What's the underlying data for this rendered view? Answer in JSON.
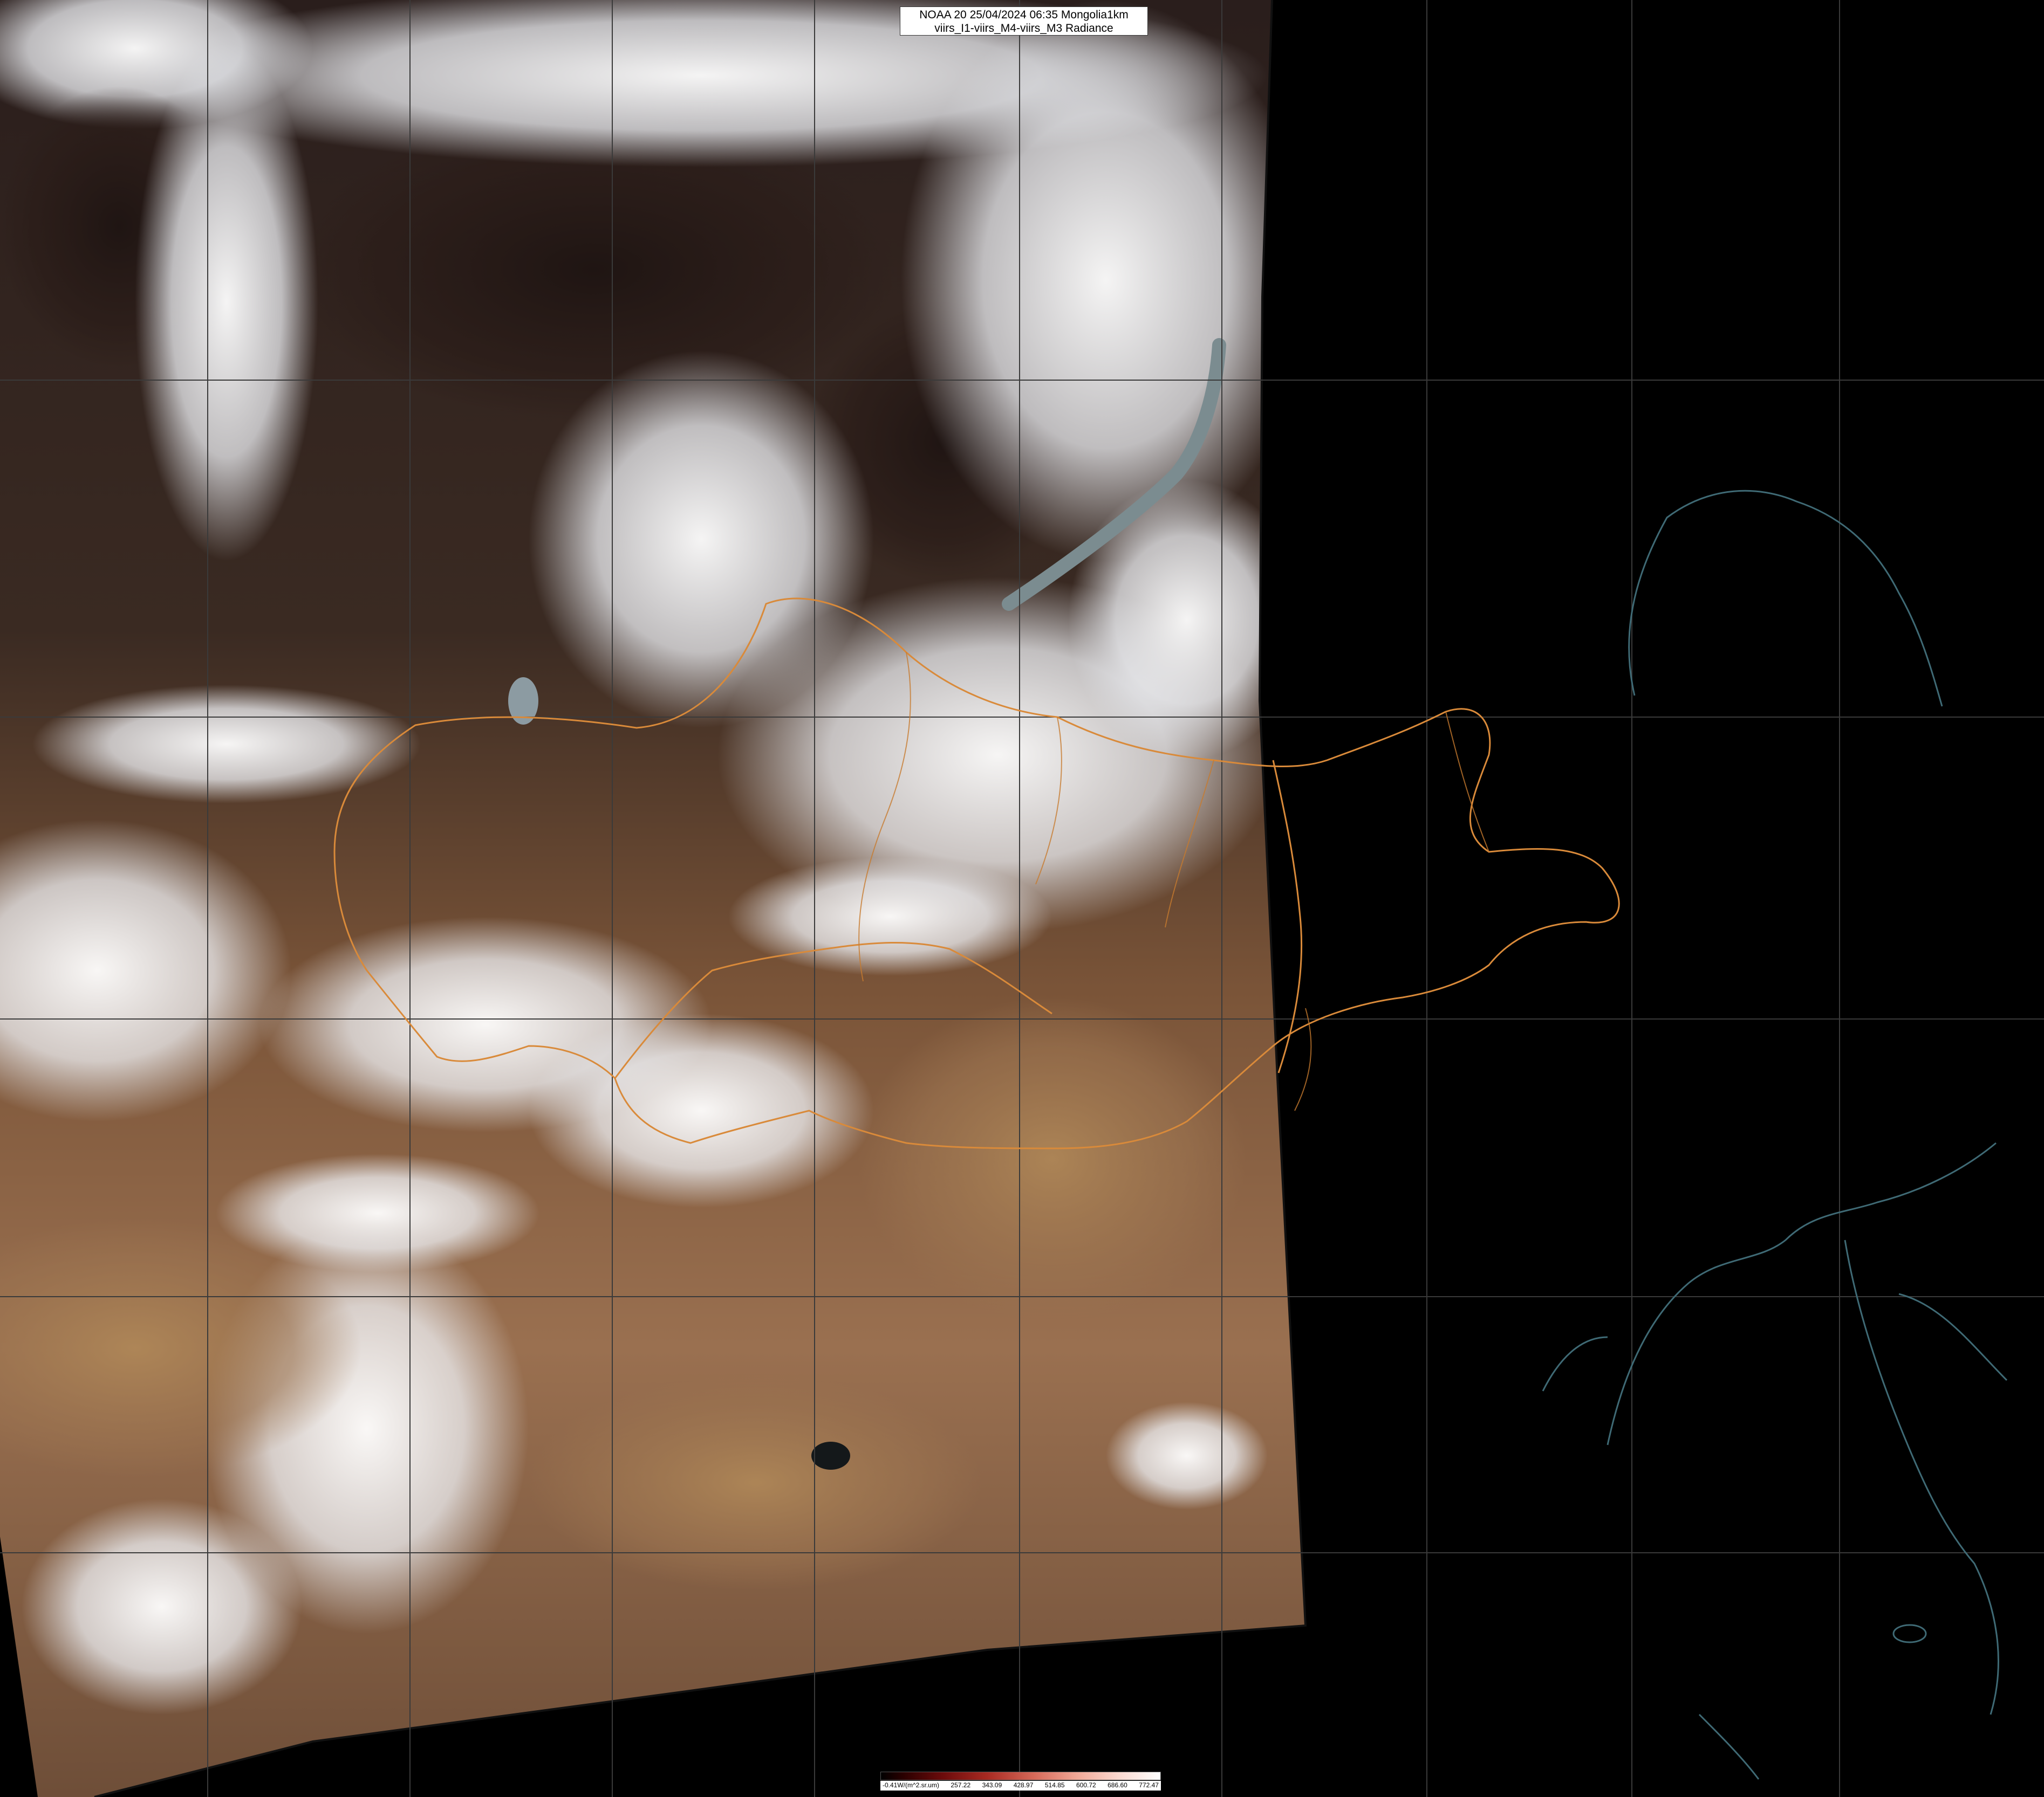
{
  "overlay": {
    "title_line1": "NOAA 20 25/04/2024 06:35 Mongolia1km",
    "title_line2": "viirs_I1-viirs_M4-viirs_M3 Radiance"
  },
  "colorbar": {
    "ticks": [
      "-0.41W/(m^2.sr.um)",
      "257.22",
      "343.09",
      "428.97",
      "514.85",
      "600.72",
      "686.60",
      "772.47"
    ],
    "colors": [
      "#000000",
      "#6b0b0b",
      "#d66a5a",
      "#ffffff"
    ]
  },
  "map": {
    "colors": {
      "background": "#000000",
      "border_line": "#d98a3a",
      "coast_line": "#3f6a75",
      "grid_line": "#3a3a3a",
      "cloud": "#f2f2f4",
      "desert": "#9c7450",
      "dark_forest": "#2a1a16"
    }
  }
}
